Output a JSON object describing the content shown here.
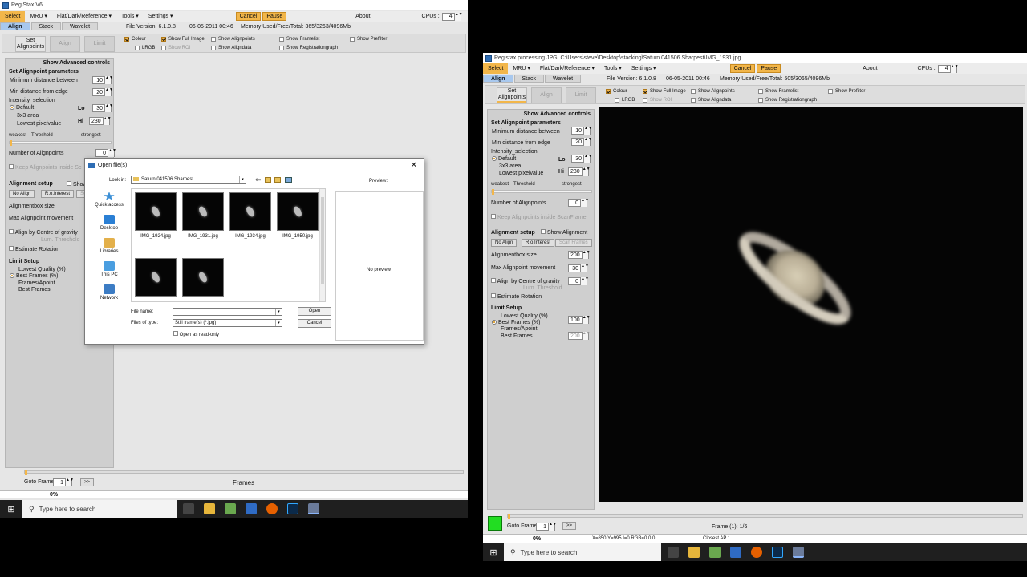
{
  "left": {
    "title": "RegiStax V6",
    "menu": {
      "select": "Select",
      "mru": "MRU",
      "flat": "Flat/Dark/Reference",
      "tools": "Tools",
      "settings": "Settings",
      "cancel": "Cancel",
      "pause": "Pause",
      "about": "About",
      "cpus_label": "CPUs :",
      "cpus_value": "4"
    },
    "tabs": [
      "Align",
      "Stack",
      "Wavelet"
    ],
    "file_version": "File Version: 6.1.0.8",
    "date": "06-05-2011 00:46",
    "memory": "Memory Used/Free/Total: 365/3263/4096Mb",
    "toolbar": {
      "set_alignpoints": "Set Alignpoints",
      "align": "Align",
      "limit": "Limit"
    },
    "checks": {
      "colour": "Colour",
      "lrgb": "LRGB",
      "show_full_image": "Show Full Image",
      "show_roi": "Show ROI",
      "show_alignpoints": "Show Alignpoints",
      "show_aligndata": "Show Aligndata",
      "show_framelist": "Show Framelist",
      "show_registrationgraph": "Show Registrationgraph",
      "show_prefilter": "Show Prefilter"
    },
    "panel": {
      "advanced": "Show Advanced controls",
      "set_header": "Set Alignpoint parameters",
      "min_dist_between": "Minimum distance between",
      "min_dist_between_val": "10",
      "min_dist_edge": "Min distance from edge",
      "min_dist_edge_val": "20",
      "intensity": "Intensity_selection",
      "default": "Default",
      "area3x3": "3x3 area",
      "lowest_pixel": "Lowest pixelvalue",
      "lo": "Lo",
      "lo_val": "30",
      "hi": "Hi",
      "hi_val": "230",
      "weakest": "weakest",
      "threshold": "Threshold",
      "strongest": "strongest",
      "num_alignpoints": "Number of Alignpoints",
      "num_alignpoints_val": "0",
      "keep": "Keep Alignpoints inside Sc",
      "show_a": "Show A",
      "align_setup": "Alignment setup",
      "no_align": "No Align",
      "r_o_interest": "R.o.Interest",
      "scan": "Scan",
      "box_size": "Alignmentbox size",
      "max_move": "Max Alignpoint movement",
      "centre_gravity": "Align by Centre of gravity",
      "lum_threshold": "Lum. Threshold",
      "estimate_rotation": "Estimate Rotation",
      "limit_setup": "Limit Setup",
      "lowest_quality": "Lowest Quality (%)",
      "best_frames": "Best Frames (%)",
      "frames_apoint": "Frames/Apoint",
      "best_frames2": "Best Frames"
    },
    "bottom": {
      "goto_frame": "Goto Frame",
      "frame_val": "1",
      "next": ">>",
      "frames": "Frames",
      "progress": "0%"
    },
    "dialog": {
      "title": "Open file(s)",
      "look_in": "Look in:",
      "folder": "Saturn 041506 Sharpest",
      "preview": "Preview:",
      "no_preview": "No preview",
      "places": [
        "Quick access",
        "Desktop",
        "Libraries",
        "This PC",
        "Network"
      ],
      "files": [
        "IMG_1924.jpg",
        "IMG_1931.jpg",
        "IMG_1934.jpg",
        "IMG_1950.jpg"
      ],
      "file_name_label": "File name:",
      "file_name_value": "",
      "files_of_type_label": "Files of type:",
      "files_of_type_value": "Still frame(s) (*.jpg)",
      "open_readonly": "Open as read-only",
      "open_btn": "Open",
      "cancel_btn": "Cancel"
    },
    "taskbar": {
      "search": "Type here to search"
    }
  },
  "right": {
    "title": "Registax processing JPG: C:\\Users\\steve\\Desktop\\stacking\\Saturn 041506 Sharpest\\IMG_1931.jpg",
    "menu": {
      "select": "Select",
      "mru": "MRU",
      "flat": "Flat/Dark/Reference",
      "tools": "Tools",
      "settings": "Settings",
      "cancel": "Cancel",
      "pause": "Pause",
      "about": "About",
      "cpus_label": "CPUs :",
      "cpus_value": "4"
    },
    "tabs": [
      "Align",
      "Stack",
      "Wavelet"
    ],
    "file_version": "File Version: 6.1.0.8",
    "date": "06-05-2011 00:46",
    "memory": "Memory Used/Free/Total: 505/3065/4096Mb",
    "toolbar": {
      "set_alignpoints": "Set Alignpoints",
      "align": "Align",
      "limit": "Limit"
    },
    "checks": {
      "colour": "Colour",
      "lrgb": "LRGB",
      "show_full_image": "Show Full Image",
      "show_roi": "Show ROI",
      "show_alignpoints": "Show Alignpoints",
      "show_aligndata": "Show Aligndata",
      "show_framelist": "Show Framelist",
      "show_registrationgraph": "Show Registrationgraph",
      "show_prefilter": "Show Prefilter"
    },
    "panel": {
      "advanced": "Show Advanced controls",
      "set_header": "Set Alignpoint parameters",
      "min_dist_between": "Minimum distance between",
      "min_dist_between_val": "10",
      "min_dist_edge": "Min distance from edge",
      "min_dist_edge_val": "20",
      "intensity": "Intensity_selection",
      "default": "Default",
      "area3x3": "3x3 area",
      "lowest_pixel": "Lowest pixelvalue",
      "lo": "Lo",
      "lo_val": "30",
      "hi": "Hi",
      "hi_val": "230",
      "weakest": "weakest",
      "threshold": "Threshold",
      "strongest": "strongest",
      "num_alignpoints": "Number of Alignpoints",
      "num_alignpoints_val": "0",
      "keep": "Keep Alignpoints inside ScanFrame",
      "align_setup": "Alignment setup",
      "show_alignment": "Show Alignment",
      "no_align": "No Align",
      "r_o_interest": "R.o.Interest",
      "scan_frames": "Scan Frames",
      "box_size": "Alignmentbox size",
      "box_size_val": "200",
      "max_move": "Max Alignpoint movement",
      "max_move_val": "30",
      "centre_gravity": "Align by Centre of gravity",
      "centre_gravity_val": "0",
      "lum_threshold": "Lum. Threshold",
      "estimate_rotation": "Estimate Rotation",
      "limit_setup": "Limit Setup",
      "lowest_quality": "Lowest Quality (%)",
      "lowest_quality_val": "100",
      "best_frames": "Best Frames (%)",
      "frames_apoint": "Frames/Apoint",
      "best_frames2": "Best Frames",
      "best_frames2_val": "200"
    },
    "bottom": {
      "goto_frame": "Goto Frame",
      "frame_val": "1",
      "next": ">>",
      "frame_info": "Frame (1): 1/6",
      "progress": "0%",
      "coords": "X=850 Y=995 I=0 RGB=0 0 0",
      "closest": "Closest AP 1"
    },
    "taskbar": {
      "search": "Type here to search"
    }
  },
  "colors": {
    "accent": "#f2b64a",
    "tab_active": "#a8c8ee",
    "indicator": "#22dd22"
  }
}
